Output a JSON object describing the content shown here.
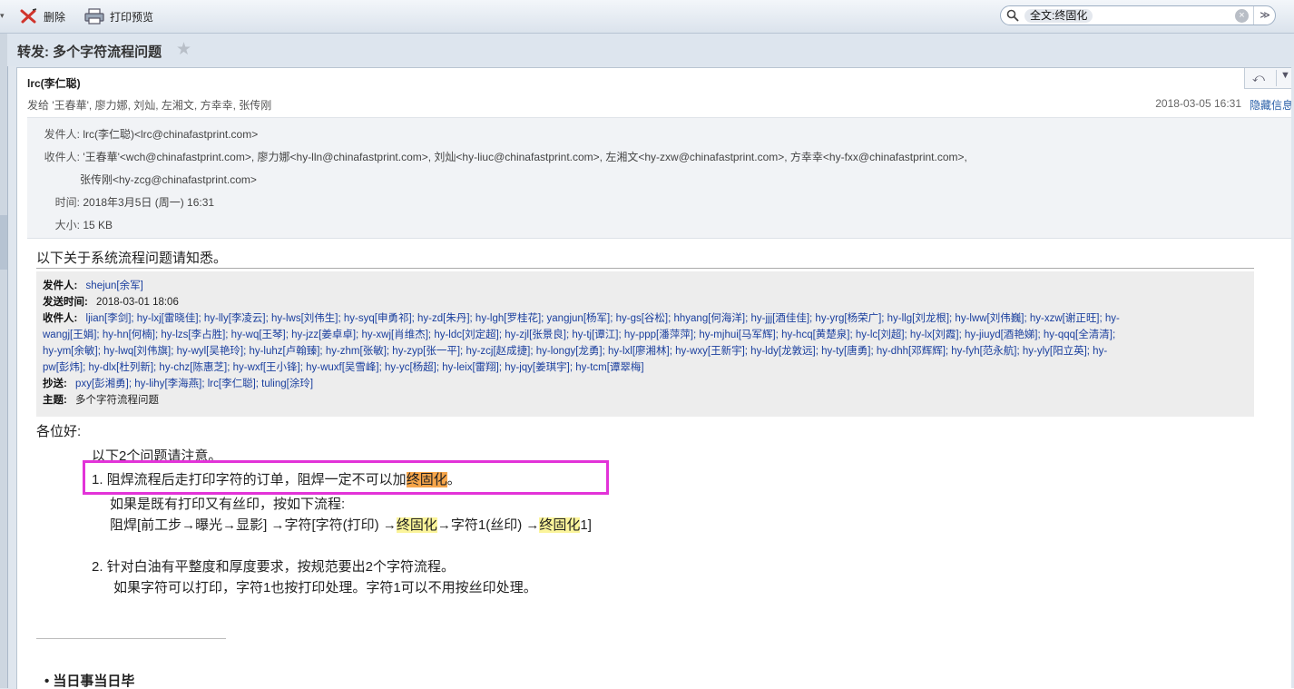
{
  "toolbar": {
    "delete_label": "删除",
    "print_preview_label": "打印预览",
    "search_chip": "全文:终固化"
  },
  "subject": "转发: 多个字符流程问题",
  "header": {
    "sender": "lrc(李仁聪)",
    "send_to": "发给 '王春華', 廖力娜, 刘灿, 左湘文, 方幸幸, 张传刚",
    "datetime": "2018-03-05 16:31",
    "hide_info": "隐藏信息"
  },
  "details": {
    "from_label": "发件人:",
    "from_value": "lrc(李仁聪)<lrc@chinafastprint.com>",
    "to_label": "收件人:",
    "to_value_line1": "'王春華'<wch@chinafastprint.com>,  廖力娜<hy-lln@chinafastprint.com>,  刘灿<hy-liuc@chinafastprint.com>,  左湘文<hy-zxw@chinafastprint.com>,  方幸幸<hy-fxx@chinafastprint.com>,",
    "to_value_line2": "张传刚<hy-zcg@chinafastprint.com>",
    "time_label": "时间:",
    "time_value": "2018年3月5日 (周一) 16:31",
    "size_label": "大小:",
    "size_value": "15 KB"
  },
  "body": {
    "intro": "以下关于系统流程问题请知悉。",
    "forwarded": {
      "from_label": "发件人:",
      "from_value": "shejun[余军]",
      "sent_label": "发送时间:",
      "sent_value": "2018-03-01 18:06",
      "to_label": "收件人:",
      "to_line1": "ljian[李剑]; hy-lxj[雷晓佳]; hy-lly[李凌云]; hy-lws[刘伟生]; hy-syq[申勇祁]; hy-zd[朱丹]; hy-lgh[罗桂花]; yangjun[杨军]; hy-gs[谷松]; hhyang[何海洋]; hy-jjj[酒佳佳]; hy-yrg[杨荣广]; hy-llg[刘龙根]; hy-lww[刘伟巍]; hy-xzw[谢正旺]; hy-",
      "to_line2": "wangj[王娟]; hy-hn[何楠]; hy-lzs[李占胜]; hy-wq[王琴]; hy-jzz[姜卓卓]; hy-xwj[肖维杰]; hy-ldc[刘定超]; hy-zjl[张景良]; hy-tj[谭江]; hy-ppp[潘萍萍]; hy-mjhui[马军辉]; hy-hcq[黄楚泉]; hy-lc[刘超]; hy-lx[刘霞]; hy-jiuyd[酒艳娣]; hy-qqq[全清清];",
      "to_line3": "hy-ym[余敏]; hy-lwq[刘伟旗]; hy-wyl[吴艳玲]; hy-luhz[卢翰臻]; hy-zhm[张敏]; hy-zyp[张一平]; hy-zcj[赵成捷]; hy-longy[龙勇]; hy-lxl[廖湘林]; hy-wxy[王新宇]; hy-ldy[龙敦远]; hy-ty[唐勇]; hy-dhh[邓辉辉]; hy-fyh[范永航]; hy-yly[阳立英]; hy-",
      "to_line4": "pw[彭炜]; hy-dlx[杜列新]; hy-chz[陈惠芝]; hy-wxf[王小锋]; hy-wuxf[吴雪峰]; hy-yc[杨超]; hy-leix[雷翔]; hy-jqy[姜琪宇]; hy-tcm[谭翠梅]",
      "cc_label": "抄送:",
      "cc_value": "pxy[彭湘勇]; hy-lihy[李海燕]; lrc[李仁聪]; tuling[涂玲]",
      "subject_label": "主题:",
      "subject_value": "多个字符流程问题"
    },
    "greeting": "各位好:",
    "note": "以下2个问题请注意。",
    "item1_prefix": "1. 阻焊流程后走打印字符的订单，阻焊一定不可以加",
    "item1_highlight": "终固化",
    "item1_suffix": "。",
    "item1_sub1": "如果是既有打印又有丝印，按如下流程:",
    "item1_sub2_a": "阻焊[前工步→曝光→显影] →字符[字符(打印) →",
    "item1_sub2_hl1": "终固化",
    "item1_sub2_b": "→字符1(丝印) →",
    "item1_sub2_hl2": "终固化",
    "item1_sub2_c": "1]",
    "item2": "2. 针对白油有平整度和厚度要求，按规范要出2个字符流程。",
    "item2_sub": "如果字符可以打印，字符1也按打印处理。字符1可以不用按丝印处理。",
    "bullet": "当日事当日毕"
  }
}
